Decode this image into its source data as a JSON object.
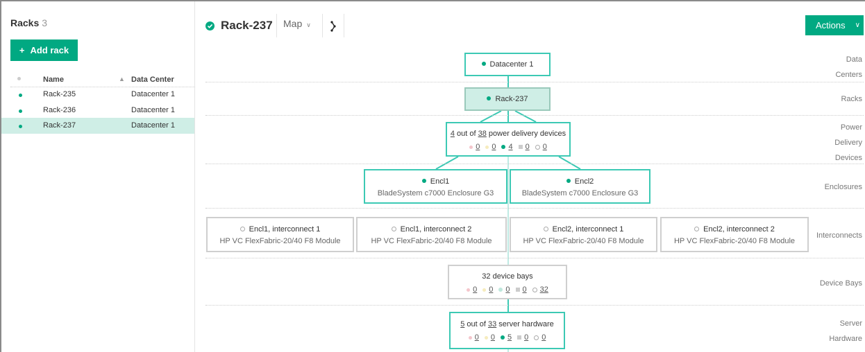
{
  "left": {
    "title": "Racks",
    "count": "3",
    "add_button": "Add rack",
    "columns": {
      "name": "Name",
      "data_center": "Data Center"
    },
    "rows": [
      {
        "name": "Rack-235",
        "data_center": "Datacenter 1",
        "status": "ok"
      },
      {
        "name": "Rack-236",
        "data_center": "Datacenter 1",
        "status": "ok"
      },
      {
        "name": "Rack-237",
        "data_center": "Datacenter 1",
        "status": "ok",
        "selected": true
      }
    ]
  },
  "header": {
    "title": "Rack-237",
    "view": "Map",
    "actions": "Actions"
  },
  "tiers": {
    "data_centers": [
      "Data",
      "Centers"
    ],
    "racks": "Racks",
    "power": [
      "Power",
      "Delivery",
      "Devices"
    ],
    "enclosures": "Enclosures",
    "interconnects": "Interconnects",
    "device_bays": "Device Bays",
    "server": [
      "Server",
      "Hardware"
    ]
  },
  "nodes": {
    "datacenter": "Datacenter 1",
    "rack": "Rack-237",
    "power": {
      "count": "4",
      "of_text": "out of",
      "total": "38",
      "suffix": "power delivery devices",
      "stats": [
        "0",
        "0",
        "4",
        "0",
        "0"
      ]
    },
    "enclosures": [
      {
        "name": "Encl1",
        "model": "BladeSystem c7000 Enclosure G3"
      },
      {
        "name": "Encl2",
        "model": "BladeSystem c7000 Enclosure G3"
      }
    ],
    "interconnects": [
      {
        "name": "Encl1, interconnect 1",
        "model": "HP VC FlexFabric-20/40 F8 Module"
      },
      {
        "name": "Encl1, interconnect 2",
        "model": "HP VC FlexFabric-20/40 F8 Module"
      },
      {
        "name": "Encl2, interconnect 1",
        "model": "HP VC FlexFabric-20/40 F8 Module"
      },
      {
        "name": "Encl2, interconnect 2",
        "model": "HP VC FlexFabric-20/40 F8 Module"
      }
    ],
    "device_bays": {
      "title": "32 device bays",
      "stats": [
        "0",
        "0",
        "0",
        "0",
        "32"
      ]
    },
    "server": {
      "count": "5",
      "of_text": "out of",
      "total": "33",
      "suffix": "server hardware",
      "stats": [
        "0",
        "0",
        "5",
        "0",
        "0"
      ]
    }
  },
  "colors": {
    "accent": "#01a982",
    "node_border": "#3cc9b4",
    "selected_bg": "#cfeee6"
  }
}
